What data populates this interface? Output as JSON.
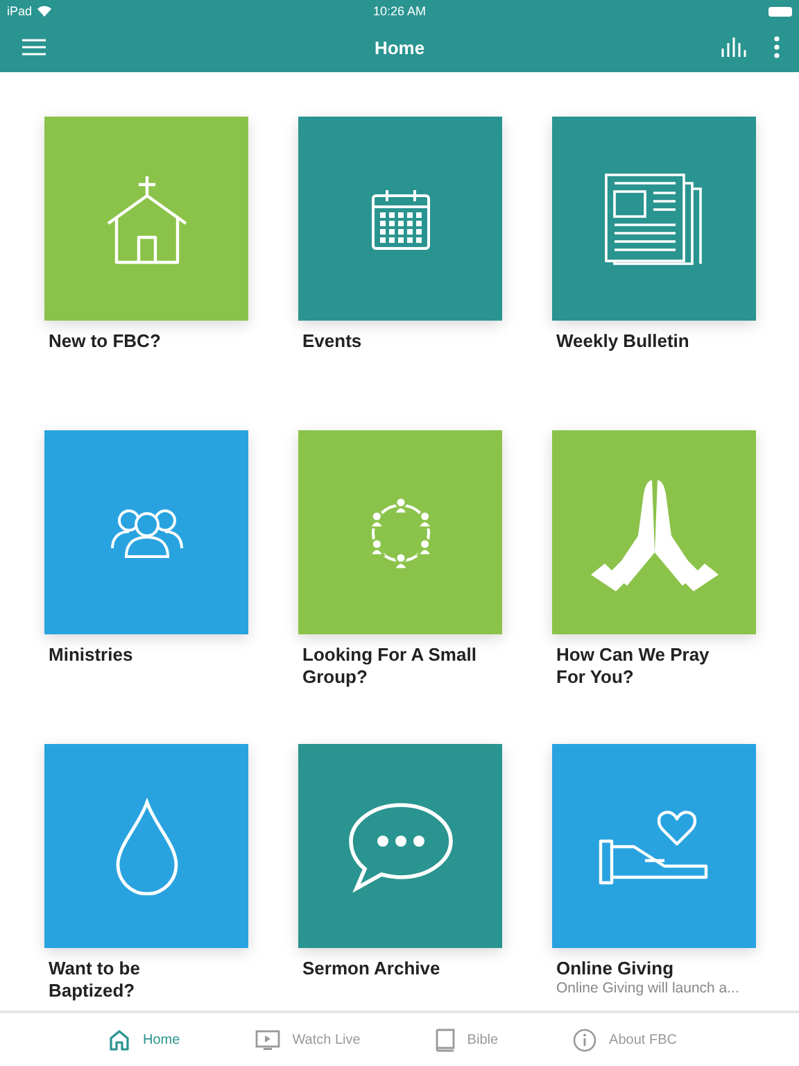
{
  "status_bar": {
    "device": "iPad",
    "time": "10:26 AM"
  },
  "header": {
    "title": "Home"
  },
  "tiles": [
    {
      "kind": "church",
      "color": "#8bc34a",
      "title": "New to FBC?"
    },
    {
      "kind": "calendar",
      "color": "#2a9490",
      "title": "Events"
    },
    {
      "kind": "newspaper",
      "color": "#2a9490",
      "title": "Weekly Bulletin"
    },
    {
      "kind": "people",
      "color": "#29a3e0",
      "title": "Ministries"
    },
    {
      "kind": "circle",
      "color": "#8bc34a",
      "title": "Looking For A Small Group?"
    },
    {
      "kind": "hands",
      "color": "#8bc34a",
      "title": "How Can We Pray For You?"
    },
    {
      "kind": "drop",
      "color": "#29a3e0",
      "title": "Want to be Baptized?"
    },
    {
      "kind": "chat",
      "color": "#2a9490",
      "title": "Sermon Archive"
    },
    {
      "kind": "giving",
      "color": "#29a3e0",
      "title": "Online Giving",
      "subtitle": "Online Giving will launch a..."
    }
  ],
  "tab_bar": [
    {
      "kind": "home",
      "label": "Home",
      "selected": true
    },
    {
      "kind": "tv",
      "label": "Watch Live",
      "selected": false
    },
    {
      "kind": "book",
      "label": "Bible",
      "selected": false
    },
    {
      "kind": "info",
      "label": "About FBC",
      "selected": false
    }
  ]
}
